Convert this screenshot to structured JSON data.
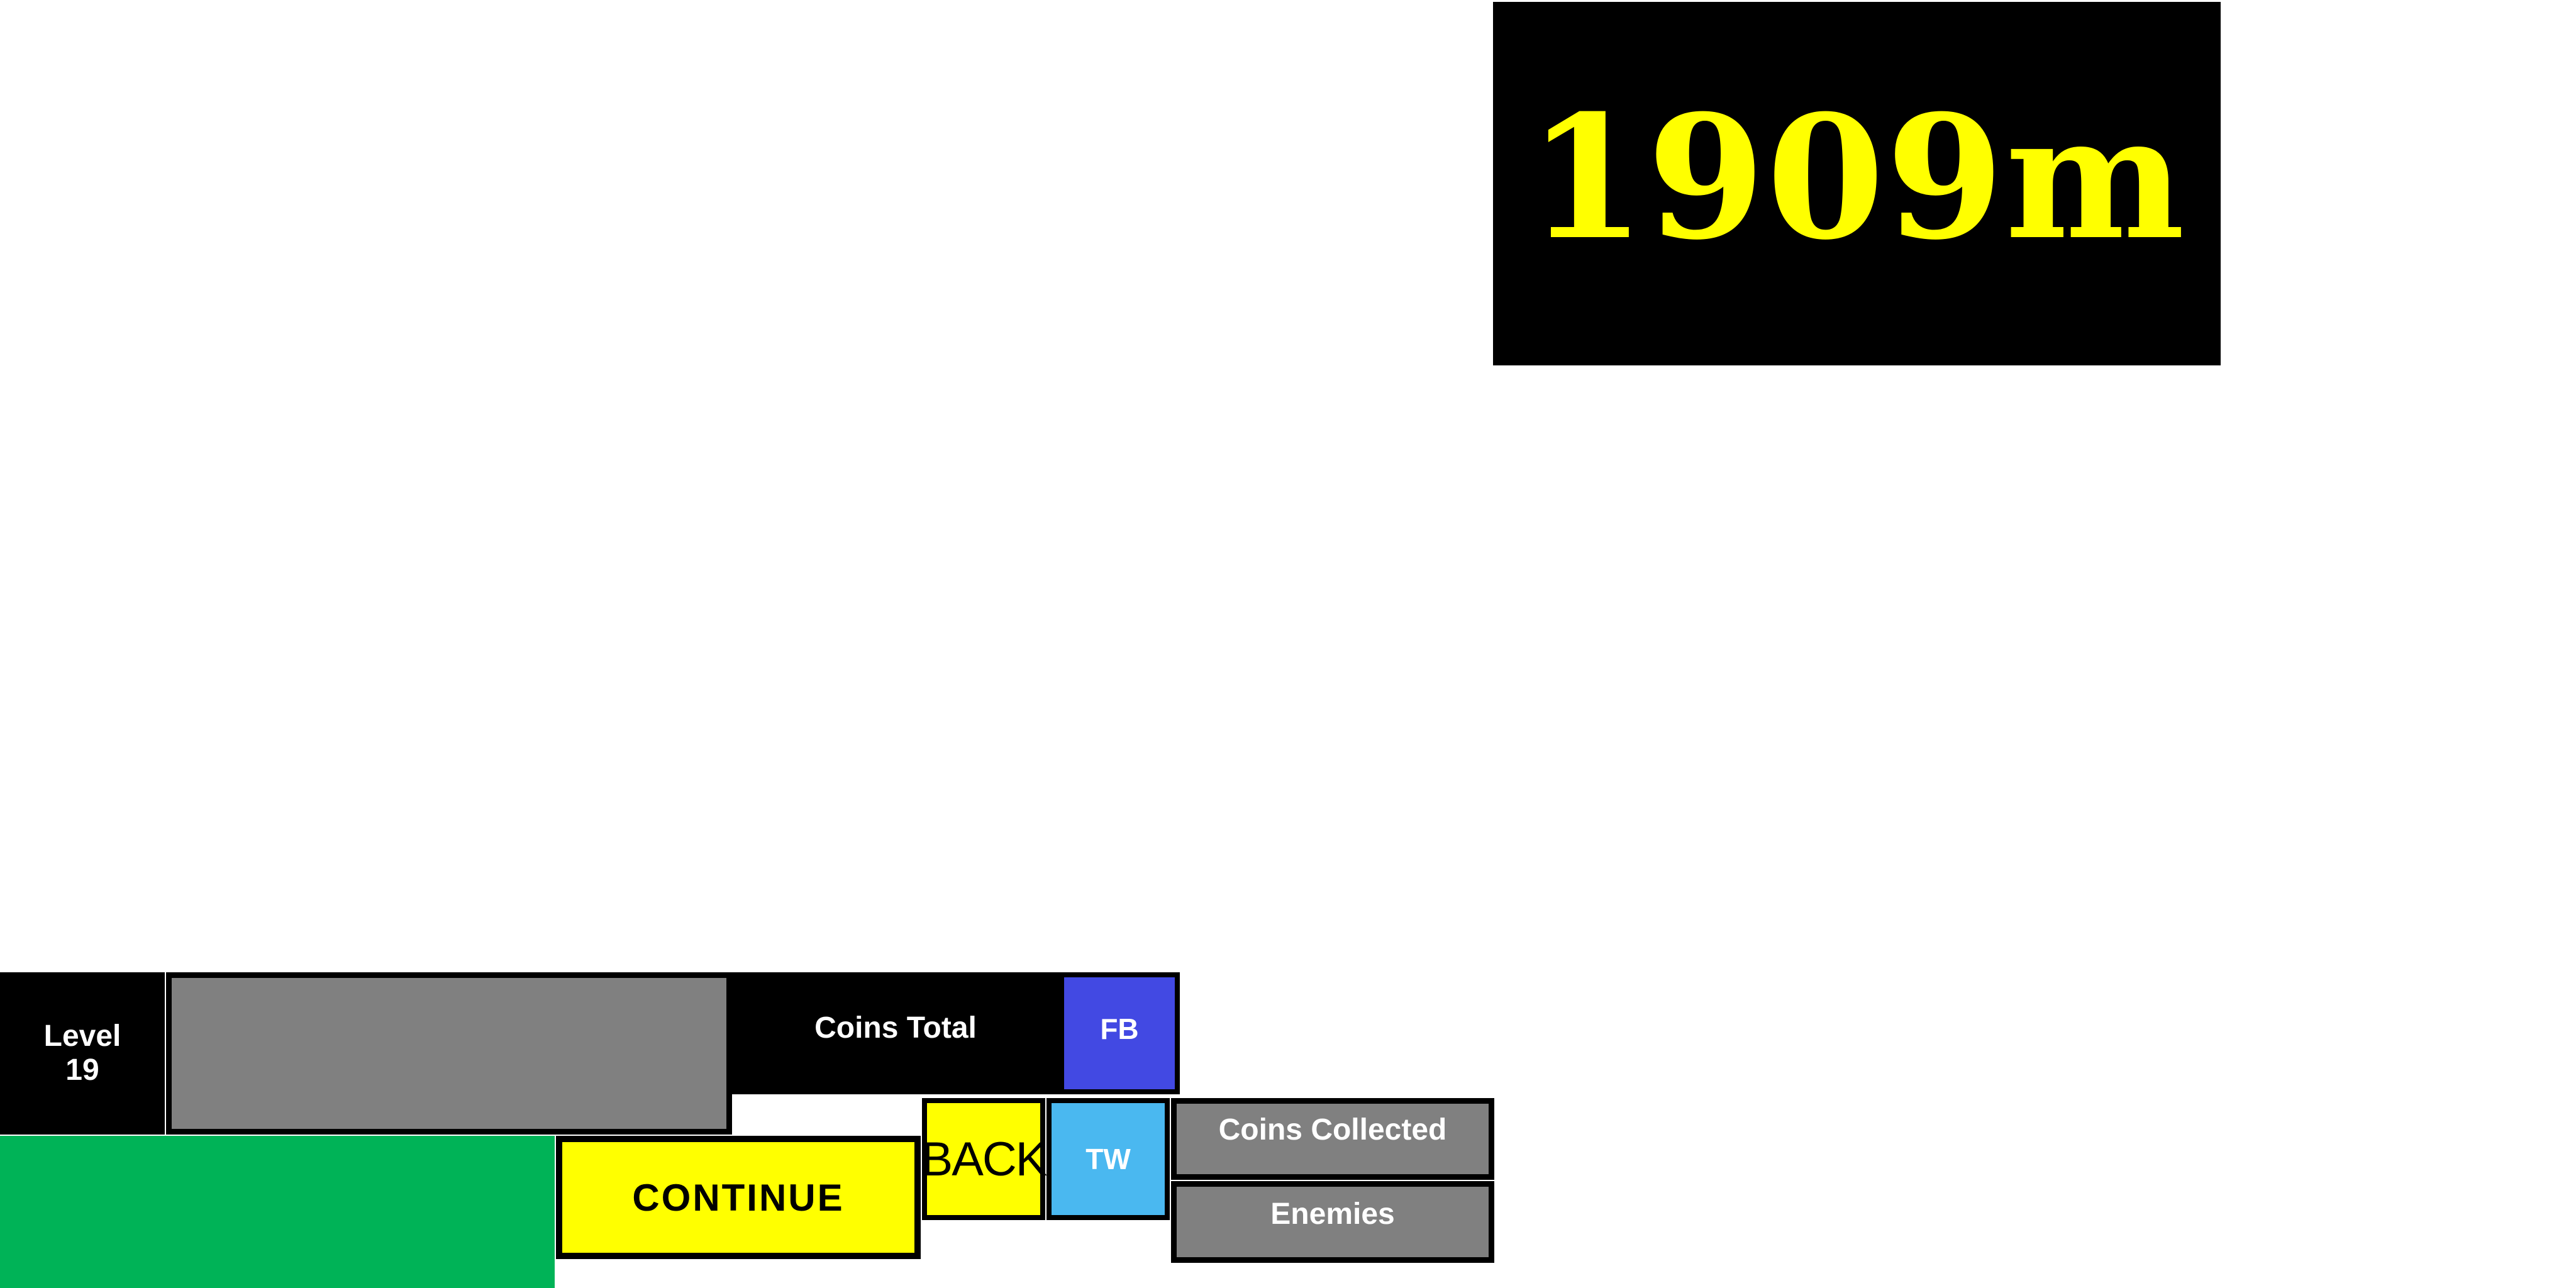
{
  "colors": {
    "panel": "#000000",
    "distance_text": "#ffff00",
    "button_yellow": "#ffff00",
    "progress_track": "#808080",
    "progress_fill": "#00b04f",
    "fb_blue": "#4249e3",
    "tw_blue": "#4ab8f0",
    "green": "#00b357",
    "stat_gray": "#808080"
  },
  "distance": {
    "value": "1909m"
  },
  "level": {
    "label": "Level",
    "number": "19"
  },
  "progress": {
    "fraction": 0
  },
  "coins_total": {
    "label": "Coins Total"
  },
  "social": {
    "fb_label": "FB",
    "tw_label": "TW"
  },
  "buttons": {
    "continue_label": "CONTINUE",
    "back_label": "BACK"
  },
  "stats": {
    "coins_collected_label": "Coins Collected",
    "enemies_label": "Enemies"
  }
}
